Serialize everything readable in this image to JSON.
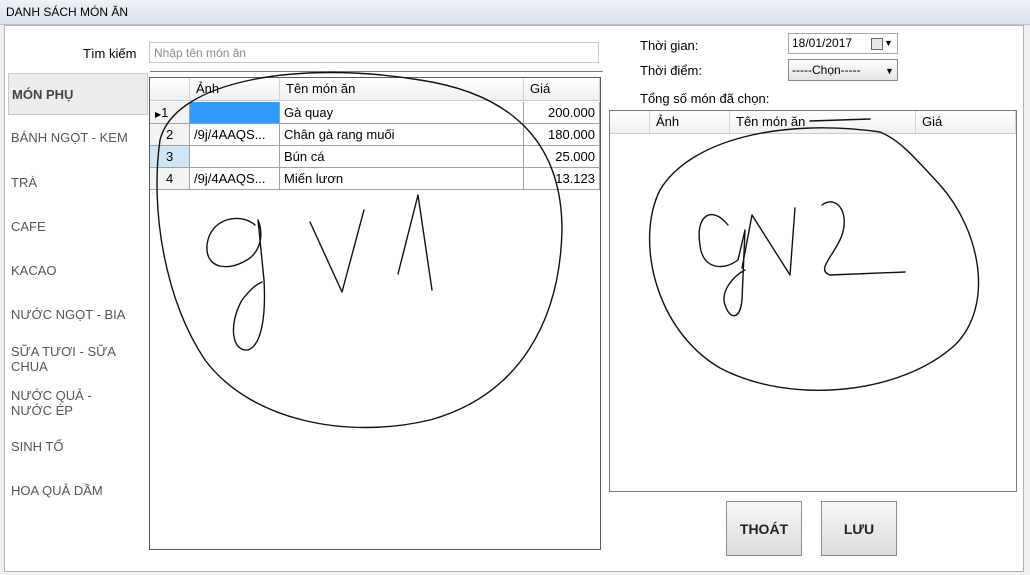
{
  "window": {
    "title": "DANH SÁCH MÓN ĂN"
  },
  "search": {
    "label": "Tìm kiếm",
    "placeholder": "Nhập tên món ăn",
    "value": ""
  },
  "categories": [
    {
      "label": "MÓN PHỤ",
      "active": true
    },
    {
      "label": "BÁNH NGỌT - KEM"
    },
    {
      "label": "TRÀ"
    },
    {
      "label": "CAFE"
    },
    {
      "label": "KACAO"
    },
    {
      "label": "NƯỚC NGỌT - BIA"
    },
    {
      "label": "SỮA TƯƠI - SỮA CHUA"
    },
    {
      "label": "NƯỚC QUẢ - NƯỚC ÉP"
    },
    {
      "label": "SINH TỐ"
    },
    {
      "label": "HOA QUẢ DẦM"
    }
  ],
  "menu_grid": {
    "columns": {
      "image": "Ảnh",
      "name": "Tên món ăn",
      "price": "Giá"
    },
    "rows": [
      {
        "num": "1",
        "image": "",
        "name": "Gà quay",
        "price": "200.000"
      },
      {
        "num": "2",
        "image": "/9j/4AAQS...",
        "name": "Chân gà rang muối",
        "price": "180.000"
      },
      {
        "num": "3",
        "image": "",
        "name": "Bún cá",
        "price": "25.000"
      },
      {
        "num": "4",
        "image": "/9j/4AAQS...",
        "name": "Miến lươn",
        "price": "13.123"
      }
    ]
  },
  "right_panel": {
    "time_label": "Thời gian:",
    "date_value": "18/01/2017",
    "moment_label": "Thời điểm:",
    "moment_value": "-----Chọn-----",
    "total_label": "Tổng số món đã chọn:"
  },
  "selected_grid": {
    "columns": {
      "image": "Ảnh",
      "name": "Tên món ăn",
      "price": "Giá"
    }
  },
  "buttons": {
    "exit": "THOÁT",
    "save": "LƯU"
  },
  "colors": {
    "selection": "#3399ff",
    "row_selector": "#cfe6f7"
  },
  "icons": {
    "date": "calendar-icon",
    "dropdown": "chevron-down-icon",
    "row_pointer": "row-pointer-icon"
  }
}
